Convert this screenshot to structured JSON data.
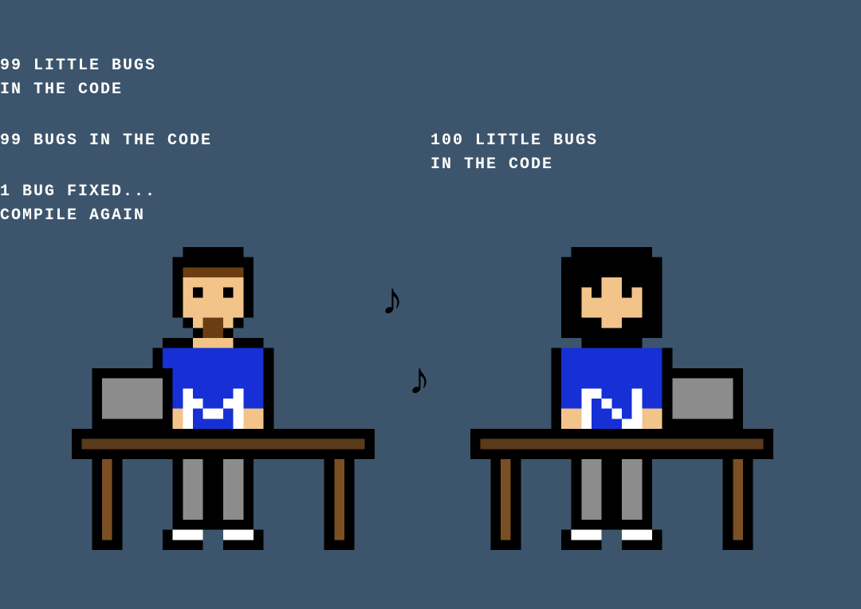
{
  "left": {
    "line1": "99 LITTLE BUGS\nIN THE CODE",
    "line2": "99 BUGS IN THE CODE",
    "line3": "1 BUG FIXED...\nCOMPILE AGAIN"
  },
  "right": {
    "line1": "100 LITTLE BUGS\nIN THE CODE"
  },
  "notes": {
    "glyph1": "♪",
    "glyph2": "♪"
  },
  "palette": {
    "bg": "#3c556c",
    "outline": "#000000",
    "skin": "#f2c48a",
    "hair_left": "#6b3e12",
    "hair_right": "#000000",
    "shirt": "#1630d6",
    "shirt_accent": "#ffffff",
    "pants": "#8c8c8c",
    "monitor": "#8c8c8c",
    "desk_top": "#5b3a1b",
    "desk_side": "#7a4f23",
    "shoe": "#ffffff"
  }
}
